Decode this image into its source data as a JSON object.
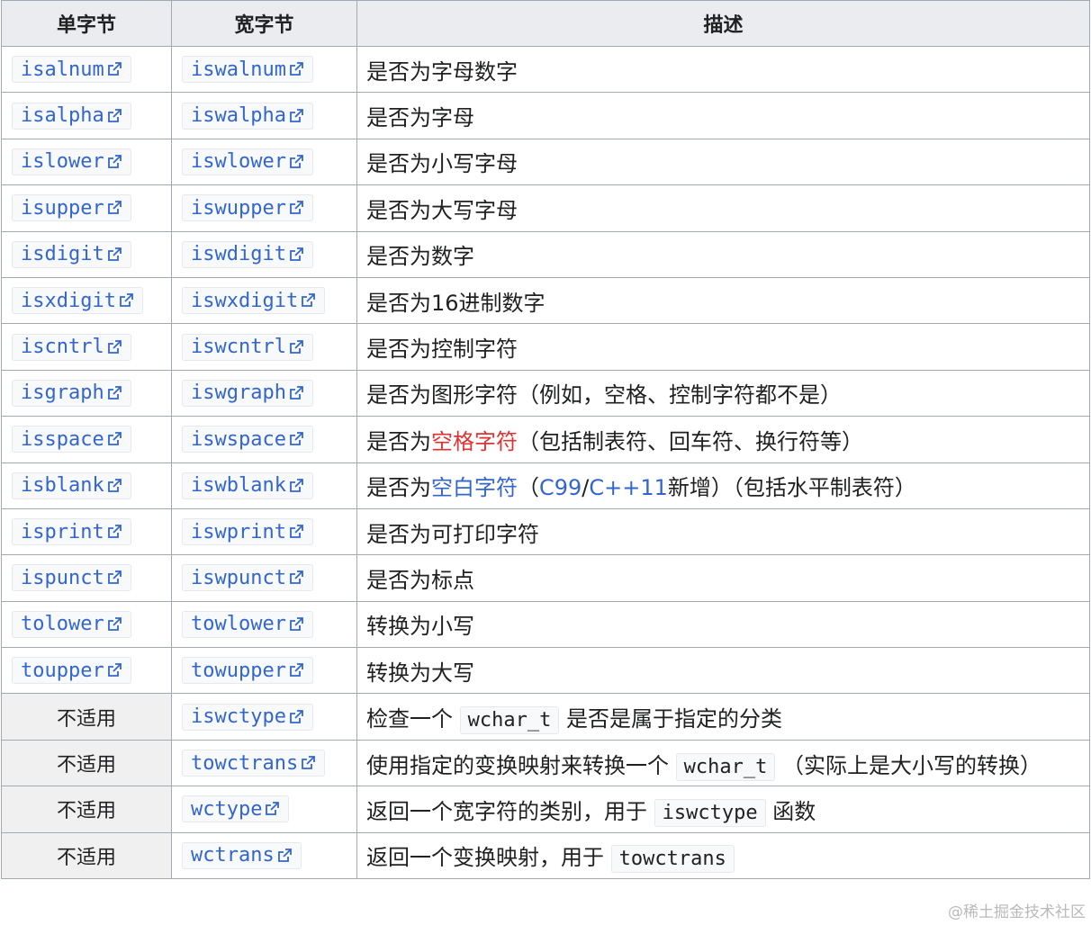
{
  "headers": {
    "single": "单字节",
    "wide": "宽字节",
    "desc": "描述"
  },
  "rows": [
    {
      "single": "isalnum",
      "wide": "iswalnum",
      "desc": "是否为字母数字"
    },
    {
      "single": "isalpha",
      "wide": "iswalpha",
      "desc": "是否为字母"
    },
    {
      "single": "islower",
      "wide": "iswlower",
      "desc": "是否为小写字母"
    },
    {
      "single": "isupper",
      "wide": "iswupper",
      "desc": "是否为大写字母"
    },
    {
      "single": "isdigit",
      "wide": "iswdigit",
      "desc": "是否为数字"
    },
    {
      "single": "isxdigit",
      "wide": "iswxdigit",
      "desc": "是否为16进制数字"
    },
    {
      "single": "iscntrl",
      "wide": "iswcntrl",
      "desc": "是否为控制字符"
    },
    {
      "single": "isgraph",
      "wide": "iswgraph",
      "desc": "是否为图形字符（例如，空格、控制字符都不是）"
    },
    {
      "single": "isspace",
      "wide": "iswspace",
      "desc_parts": {
        "pre": "是否为",
        "link": "空格字符",
        "post": "（包括制表符、回车符、换行符等）"
      }
    },
    {
      "single": "isblank",
      "wide": "iswblank",
      "desc_parts": {
        "pre": "是否为",
        "link": "空白字符",
        "mid1": "（",
        "c99": "C99",
        "slash": "/",
        "cpp": "C++11",
        "post": "新增）（包括水平制表符）"
      }
    },
    {
      "single": "isprint",
      "wide": "iswprint",
      "desc": "是否为可打印字符"
    },
    {
      "single": "ispunct",
      "wide": "iswpunct",
      "desc": "是否为标点"
    },
    {
      "single": "tolower",
      "wide": "towlower",
      "desc": "转换为小写"
    },
    {
      "single": "toupper",
      "wide": "towupper",
      "desc": "转换为大写"
    },
    {
      "single": "不适用",
      "wide": "iswctype",
      "desc_parts": {
        "pre": "检查一个",
        "code": "wchar_t",
        "post": "是否是属于指定的分类"
      }
    },
    {
      "single": "不适用",
      "wide": "towctrans",
      "desc_parts": {
        "pre": "使用指定的变换映射来转换一个",
        "code": "wchar_t",
        "post": "（实际上是大小写的转换）"
      }
    },
    {
      "single": "不适用",
      "wide": "wctype",
      "desc_parts": {
        "pre": "返回一个宽字符的类别，用于",
        "code": "iswctype",
        "post": "函数"
      }
    },
    {
      "single": "不适用",
      "wide": "wctrans",
      "desc_parts": {
        "pre": "返回一个变换映射，用于",
        "code": "towctrans",
        "post": ""
      }
    }
  ],
  "watermark": "@稀土掘金技术社区",
  "colors": {
    "link": "#3366cc",
    "visited_red": "#dd3333",
    "border": "#a2a9b1",
    "header_bg": "#eaecf0"
  },
  "icons": {
    "external": "external-link-icon"
  }
}
